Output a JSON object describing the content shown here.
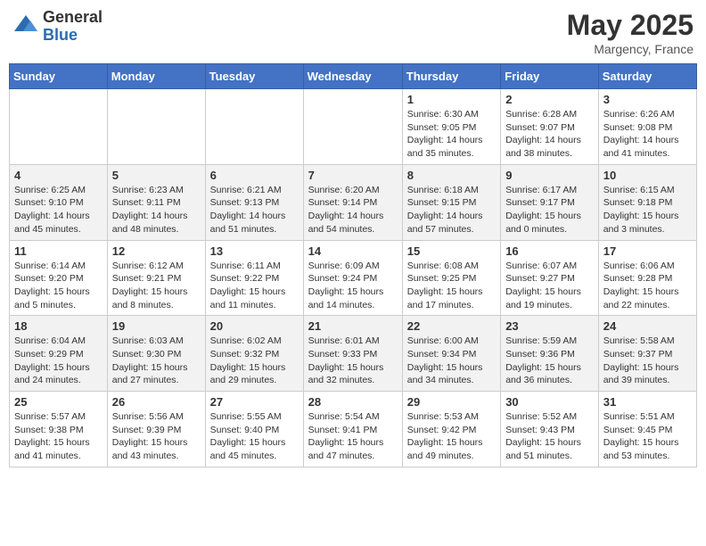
{
  "logo": {
    "general": "General",
    "blue": "Blue"
  },
  "title": {
    "month": "May 2025",
    "location": "Margency, France"
  },
  "weekdays": [
    "Sunday",
    "Monday",
    "Tuesday",
    "Wednesday",
    "Thursday",
    "Friday",
    "Saturday"
  ],
  "weeks": [
    [
      {
        "day": "",
        "info": ""
      },
      {
        "day": "",
        "info": ""
      },
      {
        "day": "",
        "info": ""
      },
      {
        "day": "",
        "info": ""
      },
      {
        "day": "1",
        "info": "Sunrise: 6:30 AM\nSunset: 9:05 PM\nDaylight: 14 hours\nand 35 minutes."
      },
      {
        "day": "2",
        "info": "Sunrise: 6:28 AM\nSunset: 9:07 PM\nDaylight: 14 hours\nand 38 minutes."
      },
      {
        "day": "3",
        "info": "Sunrise: 6:26 AM\nSunset: 9:08 PM\nDaylight: 14 hours\nand 41 minutes."
      }
    ],
    [
      {
        "day": "4",
        "info": "Sunrise: 6:25 AM\nSunset: 9:10 PM\nDaylight: 14 hours\nand 45 minutes."
      },
      {
        "day": "5",
        "info": "Sunrise: 6:23 AM\nSunset: 9:11 PM\nDaylight: 14 hours\nand 48 minutes."
      },
      {
        "day": "6",
        "info": "Sunrise: 6:21 AM\nSunset: 9:13 PM\nDaylight: 14 hours\nand 51 minutes."
      },
      {
        "day": "7",
        "info": "Sunrise: 6:20 AM\nSunset: 9:14 PM\nDaylight: 14 hours\nand 54 minutes."
      },
      {
        "day": "8",
        "info": "Sunrise: 6:18 AM\nSunset: 9:15 PM\nDaylight: 14 hours\nand 57 minutes."
      },
      {
        "day": "9",
        "info": "Sunrise: 6:17 AM\nSunset: 9:17 PM\nDaylight: 15 hours\nand 0 minutes."
      },
      {
        "day": "10",
        "info": "Sunrise: 6:15 AM\nSunset: 9:18 PM\nDaylight: 15 hours\nand 3 minutes."
      }
    ],
    [
      {
        "day": "11",
        "info": "Sunrise: 6:14 AM\nSunset: 9:20 PM\nDaylight: 15 hours\nand 5 minutes."
      },
      {
        "day": "12",
        "info": "Sunrise: 6:12 AM\nSunset: 9:21 PM\nDaylight: 15 hours\nand 8 minutes."
      },
      {
        "day": "13",
        "info": "Sunrise: 6:11 AM\nSunset: 9:22 PM\nDaylight: 15 hours\nand 11 minutes."
      },
      {
        "day": "14",
        "info": "Sunrise: 6:09 AM\nSunset: 9:24 PM\nDaylight: 15 hours\nand 14 minutes."
      },
      {
        "day": "15",
        "info": "Sunrise: 6:08 AM\nSunset: 9:25 PM\nDaylight: 15 hours\nand 17 minutes."
      },
      {
        "day": "16",
        "info": "Sunrise: 6:07 AM\nSunset: 9:27 PM\nDaylight: 15 hours\nand 19 minutes."
      },
      {
        "day": "17",
        "info": "Sunrise: 6:06 AM\nSunset: 9:28 PM\nDaylight: 15 hours\nand 22 minutes."
      }
    ],
    [
      {
        "day": "18",
        "info": "Sunrise: 6:04 AM\nSunset: 9:29 PM\nDaylight: 15 hours\nand 24 minutes."
      },
      {
        "day": "19",
        "info": "Sunrise: 6:03 AM\nSunset: 9:30 PM\nDaylight: 15 hours\nand 27 minutes."
      },
      {
        "day": "20",
        "info": "Sunrise: 6:02 AM\nSunset: 9:32 PM\nDaylight: 15 hours\nand 29 minutes."
      },
      {
        "day": "21",
        "info": "Sunrise: 6:01 AM\nSunset: 9:33 PM\nDaylight: 15 hours\nand 32 minutes."
      },
      {
        "day": "22",
        "info": "Sunrise: 6:00 AM\nSunset: 9:34 PM\nDaylight: 15 hours\nand 34 minutes."
      },
      {
        "day": "23",
        "info": "Sunrise: 5:59 AM\nSunset: 9:36 PM\nDaylight: 15 hours\nand 36 minutes."
      },
      {
        "day": "24",
        "info": "Sunrise: 5:58 AM\nSunset: 9:37 PM\nDaylight: 15 hours\nand 39 minutes."
      }
    ],
    [
      {
        "day": "25",
        "info": "Sunrise: 5:57 AM\nSunset: 9:38 PM\nDaylight: 15 hours\nand 41 minutes."
      },
      {
        "day": "26",
        "info": "Sunrise: 5:56 AM\nSunset: 9:39 PM\nDaylight: 15 hours\nand 43 minutes."
      },
      {
        "day": "27",
        "info": "Sunrise: 5:55 AM\nSunset: 9:40 PM\nDaylight: 15 hours\nand 45 minutes."
      },
      {
        "day": "28",
        "info": "Sunrise: 5:54 AM\nSunset: 9:41 PM\nDaylight: 15 hours\nand 47 minutes."
      },
      {
        "day": "29",
        "info": "Sunrise: 5:53 AM\nSunset: 9:42 PM\nDaylight: 15 hours\nand 49 minutes."
      },
      {
        "day": "30",
        "info": "Sunrise: 5:52 AM\nSunset: 9:43 PM\nDaylight: 15 hours\nand 51 minutes."
      },
      {
        "day": "31",
        "info": "Sunrise: 5:51 AM\nSunset: 9:45 PM\nDaylight: 15 hours\nand 53 minutes."
      }
    ]
  ]
}
